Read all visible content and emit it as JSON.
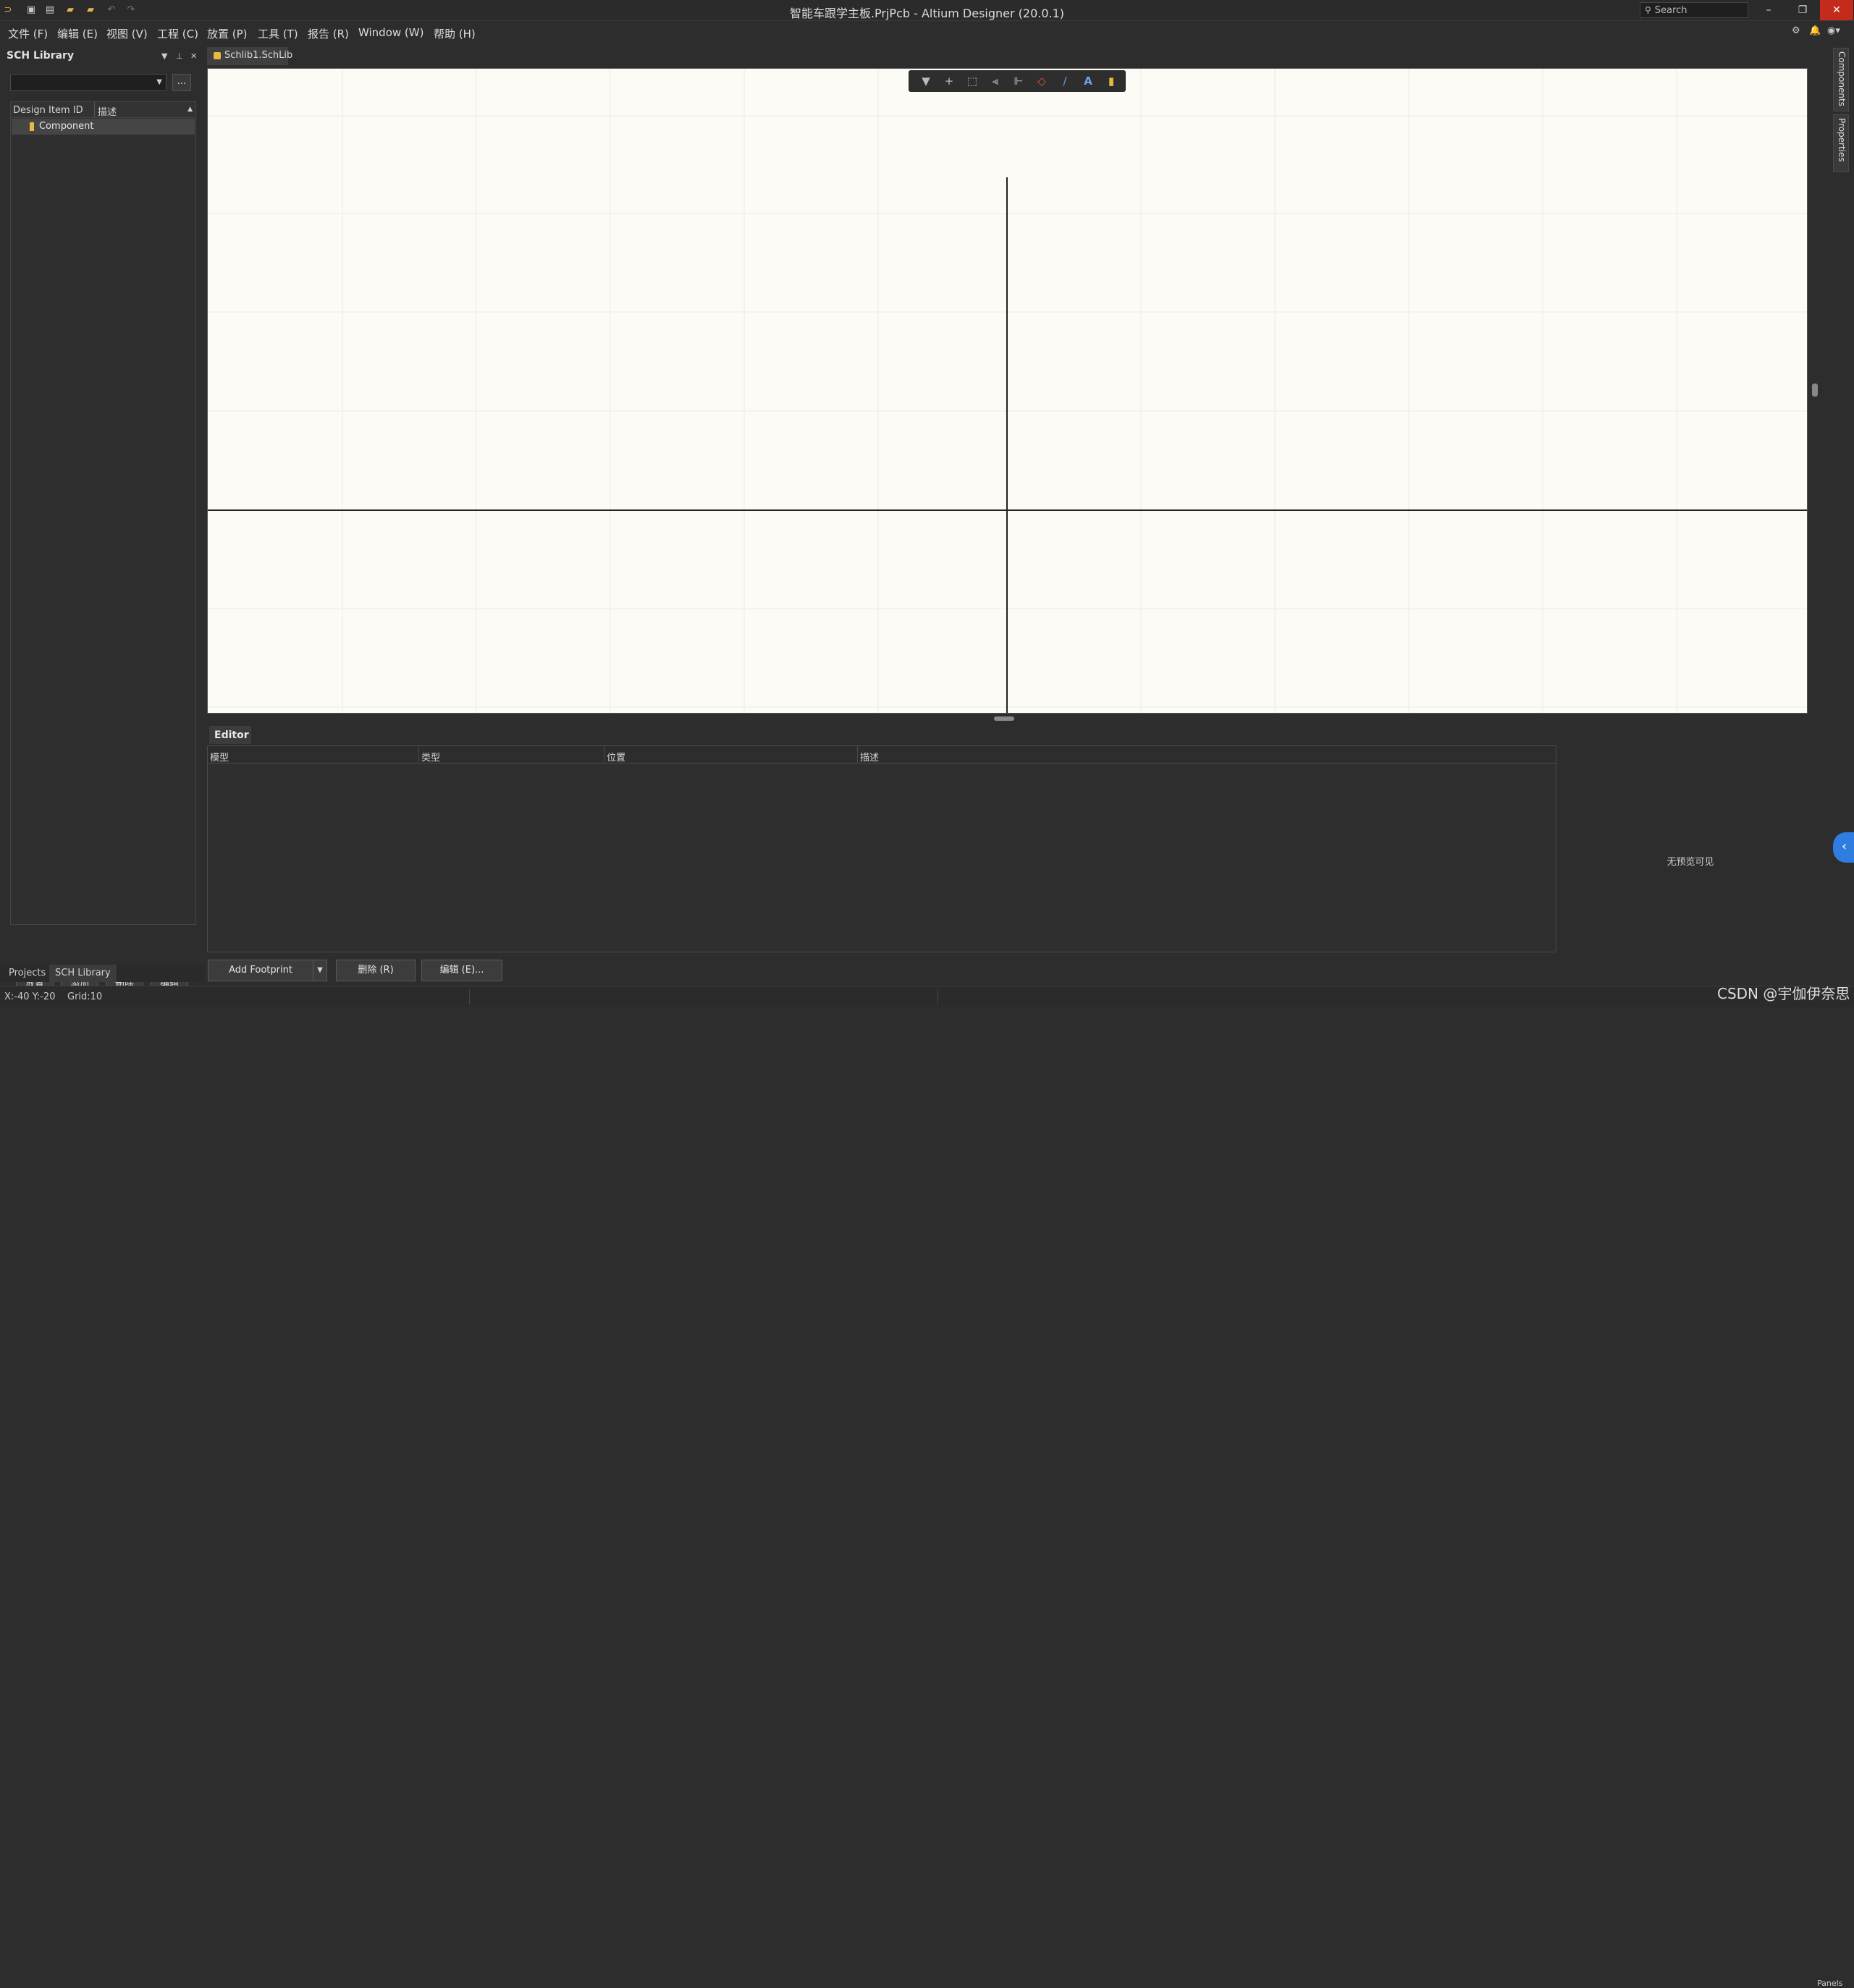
{
  "window": {
    "title": "智能车跟学主板.PrjPcb - Altium Designer (20.0.1)",
    "search_placeholder": "Search"
  },
  "quick_access": [
    "app-logo-icon",
    "save-icon",
    "save-all-icon",
    "open-icon",
    "open-project-icon",
    "undo-icon",
    "redo-icon"
  ],
  "menu": [
    "文件 (F)",
    "编辑 (E)",
    "视图 (V)",
    "工程 (C)",
    "放置 (P)",
    "工具 (T)",
    "报告 (R)",
    "Window (W)",
    "帮助 (H)"
  ],
  "left_panel": {
    "title": "SCH Library",
    "columns": [
      "Design Item ID",
      "描述"
    ],
    "rows": [
      "Component"
    ],
    "buttons": [
      "放置",
      "添加",
      "删除",
      "编辑"
    ],
    "ellipsis": "...",
    "tabs": [
      "Projects",
      "SCH Library"
    ]
  },
  "document": {
    "tab": "Schlib1.SchLib"
  },
  "editor": {
    "tab": "Editor",
    "columns": [
      "模型",
      "类型",
      "位置",
      "描述"
    ],
    "no_preview": "无预览可见",
    "buttons": {
      "add_footprint": "Add Footprint",
      "delete": "删除 (R)",
      "edit": "编辑 (E)..."
    }
  },
  "right_panels": [
    "Components",
    "Properties"
  ],
  "status": {
    "coords": "X:-40 Y:-20",
    "grid": "Grid:10",
    "panels": "Panels"
  },
  "watermark": "CSDN @宇伽伊奈思"
}
